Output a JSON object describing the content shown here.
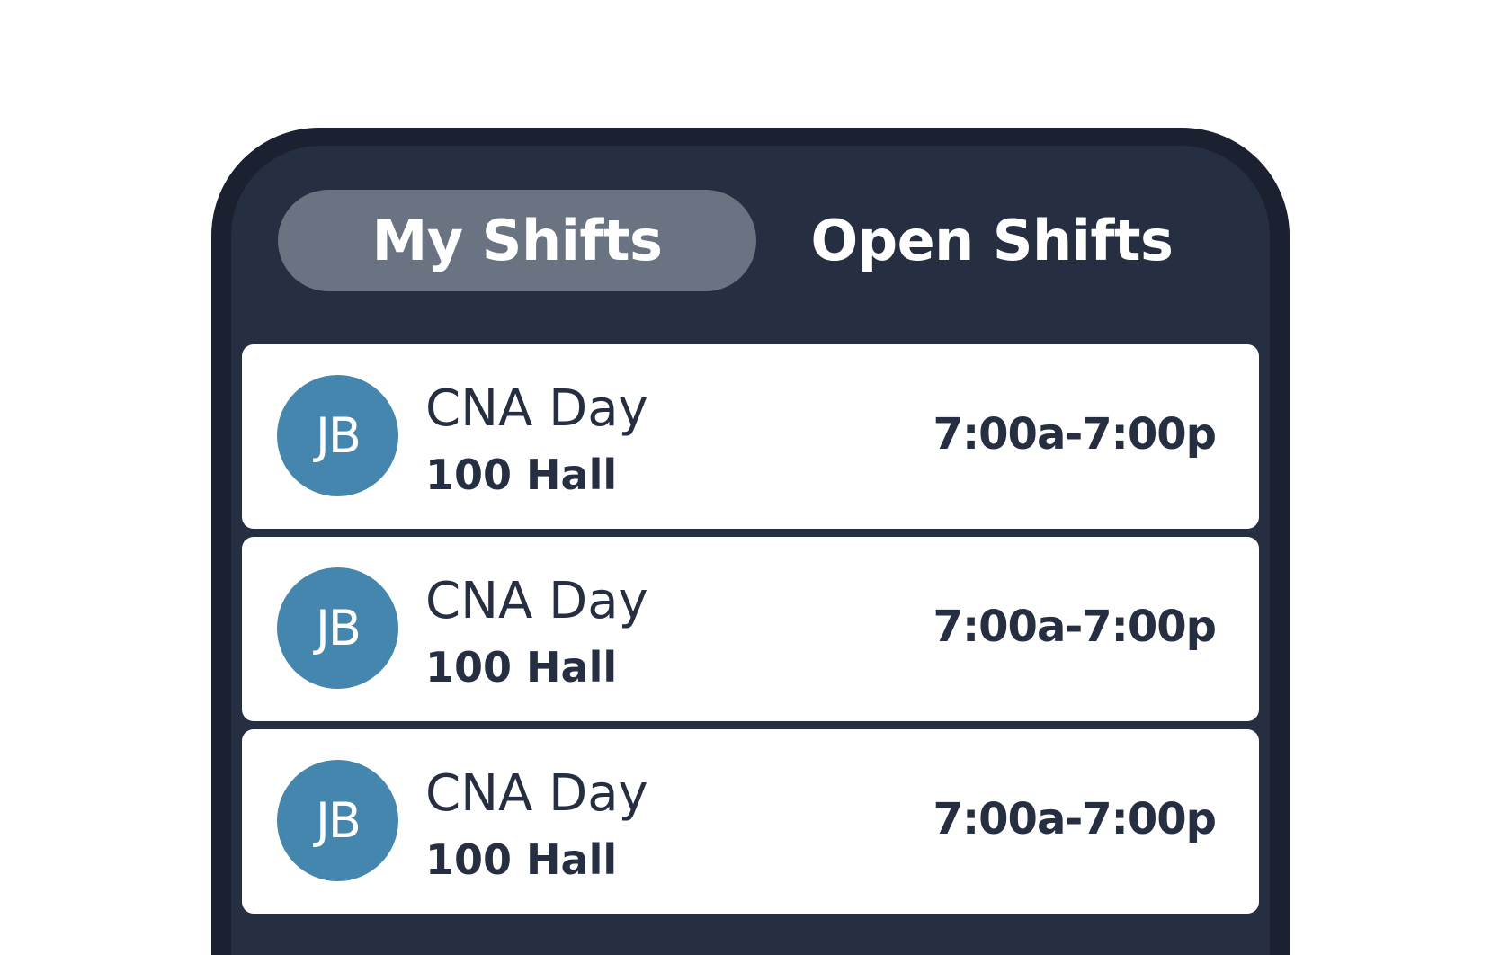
{
  "tabs": {
    "my_shifts_label": "My Shifts",
    "open_shifts_label": "Open Shifts",
    "active": "My Shifts"
  },
  "shifts": [
    {
      "initials": "JB",
      "title": "CNA Day",
      "location": "100 Hall",
      "time": "7:00a-7:00p"
    },
    {
      "initials": "JB",
      "title": "CNA Day",
      "location": "100 Hall",
      "time": "7:00a-7:00p"
    },
    {
      "initials": "JB",
      "title": "CNA Day",
      "location": "100 Hall",
      "time": "7:00a-7:00p"
    }
  ],
  "colors": {
    "frame": "#1b2130",
    "screen": "#262f42",
    "active_tab": "#6a7382",
    "avatar": "#4586ae",
    "card": "#ffffff",
    "text_dark": "#262f42"
  }
}
